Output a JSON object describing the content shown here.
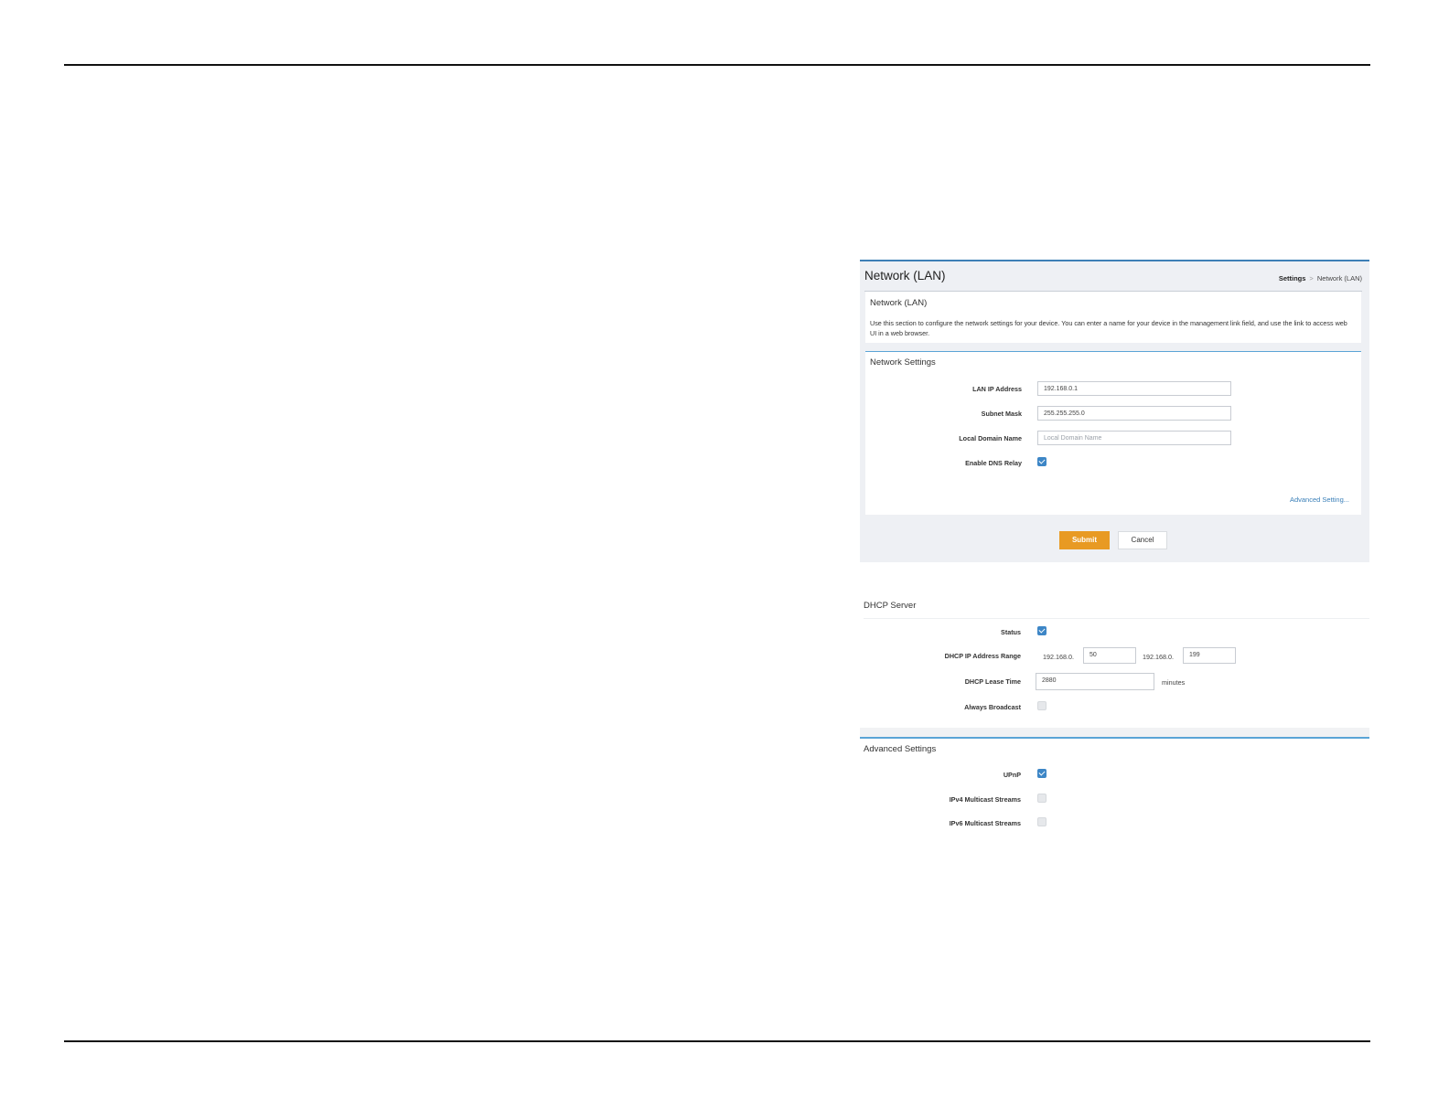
{
  "panel": {
    "title": "Network (LAN)",
    "breadcrumb": [
      "Settings",
      "Network (LAN)"
    ],
    "breadcrumb_sep": ">",
    "info_title": "Network (LAN)",
    "info_text": "Use this section to configure the network settings for your device. You can enter a name for your device in the management link field, and use the link to access web UI in a web browser."
  },
  "network_settings": {
    "title": "Network Settings",
    "lan_ip_label": "LAN IP Address",
    "lan_ip_value": "192.168.0.1",
    "subnet_label": "Subnet Mask",
    "subnet_value": "255.255.255.0",
    "domain_label": "Local Domain Name",
    "domain_placeholder": "Local Domain Name",
    "dns_relay_label": "Enable DNS Relay",
    "dns_relay_checked": true,
    "advanced_link": "Advanced Setting..."
  },
  "buttons": {
    "submit": "Submit",
    "cancel": "Cancel"
  },
  "dhcp": {
    "title": "DHCP Server",
    "status_label": "Status",
    "status_checked": true,
    "range_label": "DHCP IP Address Range",
    "range_prefix_start": "192.168.0.",
    "range_start": "50",
    "range_prefix_end": "192.168.0.",
    "range_end": "199",
    "lease_label": "DHCP Lease Time",
    "lease_value": "2880",
    "lease_unit": "minutes",
    "broadcast_label": "Always Broadcast",
    "broadcast_checked": false
  },
  "advanced": {
    "title": "Advanced Settings",
    "upnp_label": "UPnP",
    "upnp_checked": true,
    "ipv4_label": "IPv4 Multicast Streams",
    "ipv4_checked": false,
    "ipv6_label": "IPv6 Multicast Streams",
    "ipv6_checked": false
  },
  "colors": {
    "accent": "#3d86c6",
    "submit": "#e89a23",
    "link": "#3a7fb8"
  }
}
